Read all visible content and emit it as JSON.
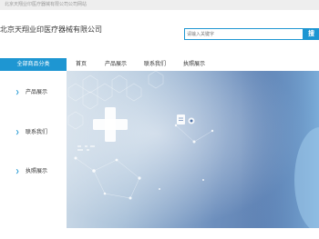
{
  "topbar": {
    "text": "北京天翔业印医疗器械有限公司公司网站"
  },
  "header": {
    "company_name": "北京天翔业印医疗器械有限公司",
    "search": {
      "placeholder": "请输入关键字",
      "button_label": "搜"
    }
  },
  "nav": {
    "category_label": "全部商品分类",
    "items": [
      {
        "label": "首页"
      },
      {
        "label": "产品展示"
      },
      {
        "label": "联系我们"
      },
      {
        "label": "执照展示"
      }
    ]
  },
  "sidebar": {
    "items": [
      {
        "label": "产品展示"
      },
      {
        "label": "联系我们"
      },
      {
        "label": "执照展示"
      }
    ]
  },
  "colors": {
    "accent": "#1e96d2"
  },
  "icons": {
    "sidebar_item": "chevron-right-icon"
  }
}
